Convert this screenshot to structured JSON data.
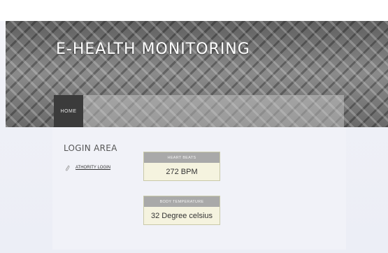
{
  "site": {
    "title": "E-HEALTH MONITORING"
  },
  "nav": {
    "items": [
      {
        "label": "HOME"
      }
    ]
  },
  "login": {
    "heading": "LOGIN AREA",
    "link_label": "ATHORITY LOGIN",
    "link_icon": "paperclip-icon"
  },
  "readings": [
    {
      "label": "HEART BEATS",
      "value": "272 BPM"
    },
    {
      "label": "BODY TEMPERATURE",
      "value": "32 Degree celsius"
    }
  ]
}
